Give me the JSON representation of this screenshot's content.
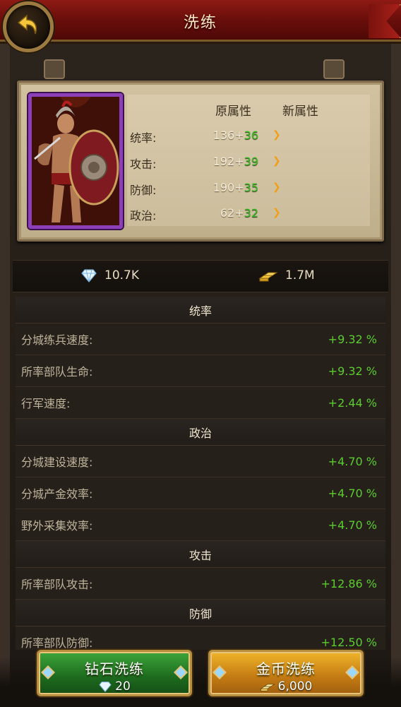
{
  "header": {
    "title": "洗练"
  },
  "hero": {
    "col_original": "原属性",
    "col_new": "新属性",
    "stats": [
      {
        "label": "统率:",
        "base": "136",
        "bonus": "36"
      },
      {
        "label": "攻击:",
        "base": "192",
        "bonus": "39"
      },
      {
        "label": "防御:",
        "base": "190",
        "bonus": "35"
      },
      {
        "label": "政治:",
        "base": "62",
        "bonus": "32"
      }
    ]
  },
  "resources": {
    "diamonds": "10.7K",
    "gold": "1.7M"
  },
  "sections": [
    {
      "title": "统率",
      "rows": [
        {
          "label": "分城练兵速度:",
          "value": "+9.32 %"
        },
        {
          "label": "所率部队生命:",
          "value": "+9.32 %"
        },
        {
          "label": "行军速度:",
          "value": "+2.44 %"
        }
      ]
    },
    {
      "title": "政治",
      "rows": [
        {
          "label": "分城建设速度:",
          "value": "+4.70 %"
        },
        {
          "label": "分城产金效率:",
          "value": "+4.70 %"
        },
        {
          "label": "野外采集效率:",
          "value": "+4.70 %"
        }
      ]
    },
    {
      "title": "攻击",
      "rows": [
        {
          "label": "所率部队攻击:",
          "value": "+12.86 %"
        }
      ]
    },
    {
      "title": "防御",
      "rows": [
        {
          "label": "所率部队防御:",
          "value": "+12.50 %"
        }
      ]
    }
  ],
  "buttons": {
    "diamond_refine": {
      "label": "钻石洗练",
      "cost": "20"
    },
    "gold_refine": {
      "label": "金币洗练",
      "cost": "6,000"
    }
  },
  "colors": {
    "bonus_green": "#3fbe2a",
    "value_green": "#5ccc2e",
    "header_red": "#8e1a14"
  }
}
